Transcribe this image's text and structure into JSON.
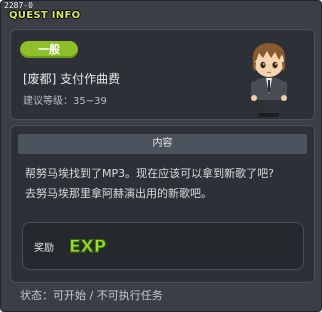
{
  "window": {
    "quest_id": "2287-0",
    "title": "QUEST INFO"
  },
  "quest": {
    "category": "一般",
    "name": "[废都] 支付作曲费",
    "level": "建议等级：35~39",
    "npc": "npc-portrait"
  },
  "content": {
    "header": "内容",
    "line1": "帮努马埃找到了MP3。现在应该可以拿到新歌了吧?",
    "line2": "去努马埃那里拿阿赫演出用的新歌吧。"
  },
  "reward": {
    "label": "奖励",
    "icon": "exp-icon",
    "icon_text": "EXP"
  },
  "status": {
    "text": "状态：可开始 / 不可执行任务"
  },
  "colors": {
    "window_bg": "#3b3f45",
    "panel_bg": "#2d3137",
    "title_color": "#d9e86a",
    "badge_green": "#8fbf2b",
    "exp_green": "#9fe02a"
  }
}
